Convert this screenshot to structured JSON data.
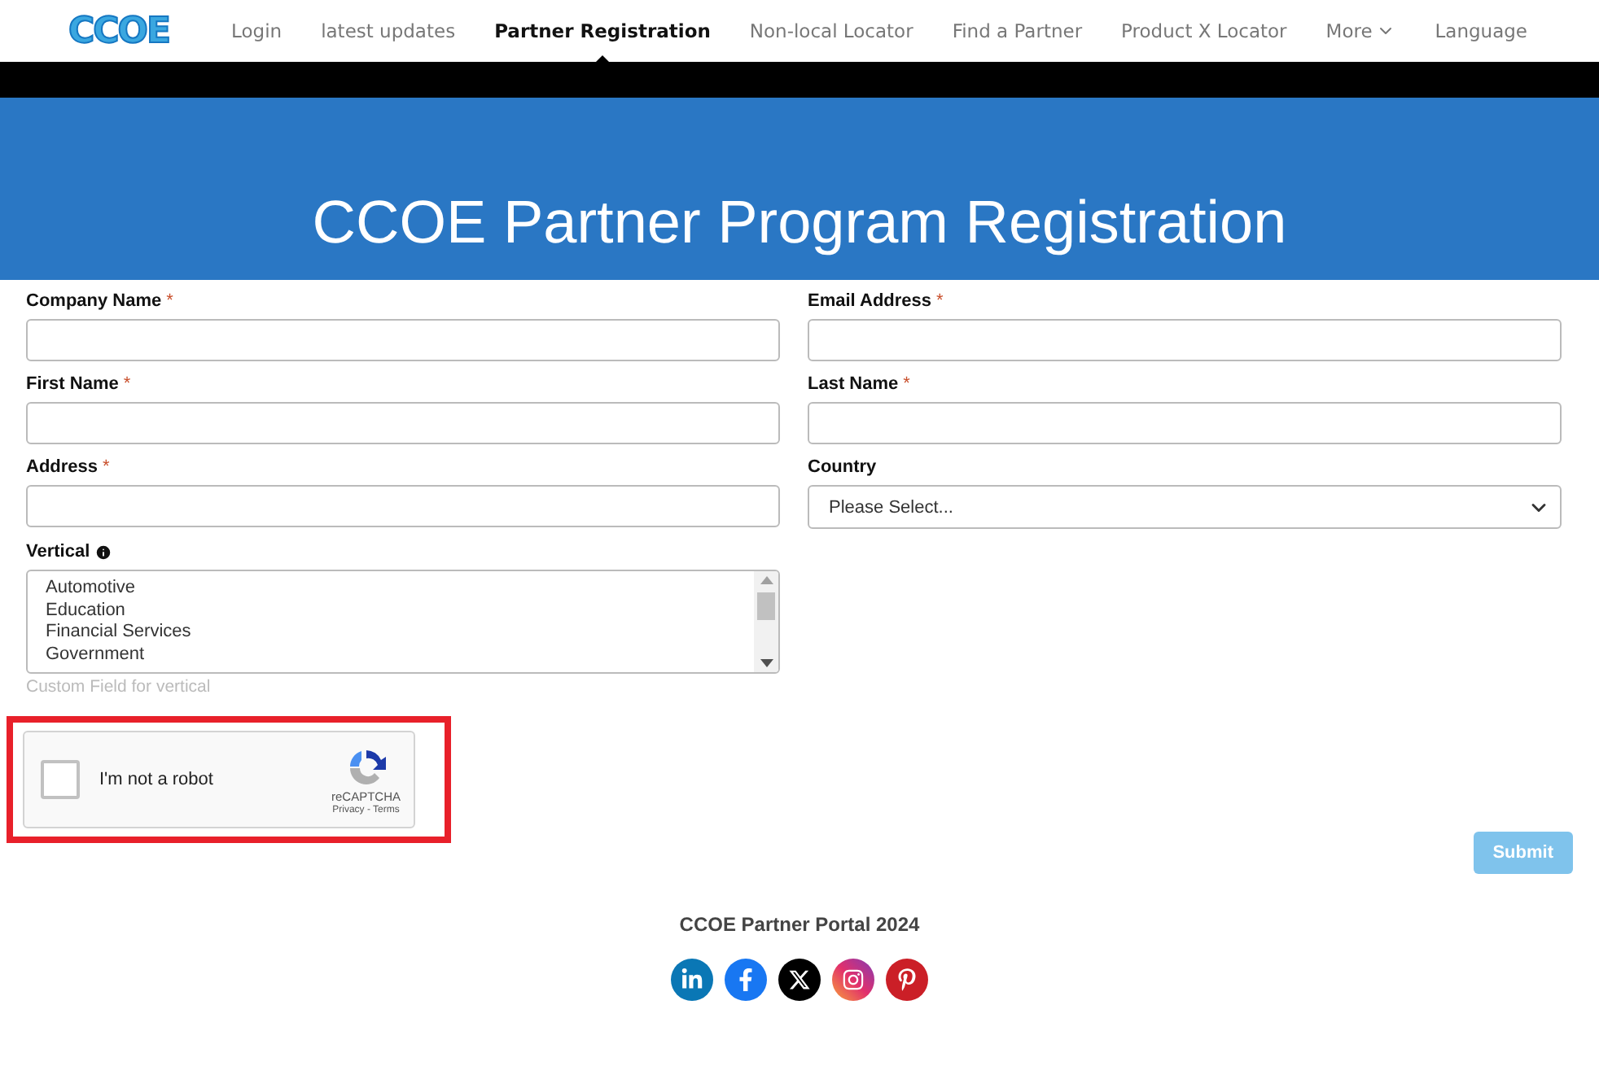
{
  "nav": {
    "logo": "CCOE",
    "items": [
      {
        "label": "Login",
        "selected": false
      },
      {
        "label": "latest updates",
        "selected": false
      },
      {
        "label": "Partner Registration",
        "selected": true
      },
      {
        "label": "Non-local Locator",
        "selected": false
      },
      {
        "label": "Find a Partner",
        "selected": false
      },
      {
        "label": "Product X Locator",
        "selected": false
      },
      {
        "label": "More",
        "selected": false,
        "kind": "dropdown"
      }
    ],
    "language": "Language"
  },
  "banner": {
    "title": "CCOE Partner Program Registration"
  },
  "form": {
    "fields": [
      {
        "kind": "text",
        "label": "Company Name",
        "mark": "*"
      },
      {
        "kind": "text",
        "label": "Email Address",
        "mark": "*"
      },
      {
        "kind": "text",
        "label": "First Name",
        "mark": "*"
      },
      {
        "kind": "text",
        "label": "Last Name",
        "mark": "*"
      },
      {
        "kind": "text",
        "label": "Address",
        "mark": "*"
      },
      {
        "kind": "select",
        "label": "Country",
        "value": "Please Select..."
      },
      {
        "kind": "listbox",
        "label": "Vertical",
        "info": true,
        "options": [
          "Automotive",
          "Education",
          "Financial Services",
          "Government"
        ],
        "hint": "Custom Field for vertical"
      }
    ],
    "captcha": {
      "label": "I'm not a robot",
      "checked": false,
      "brand": "reCAPTCHA",
      "privacy": "Privacy",
      "separator": "-",
      "terms": "Terms"
    },
    "submit": "Submit"
  },
  "footer": {
    "text": "CCOE Partner Portal 2024",
    "social": [
      {
        "kind": "linkedin"
      },
      {
        "kind": "facebook"
      },
      {
        "kind": "x"
      },
      {
        "kind": "instagram"
      },
      {
        "kind": "pinterest"
      }
    ]
  }
}
